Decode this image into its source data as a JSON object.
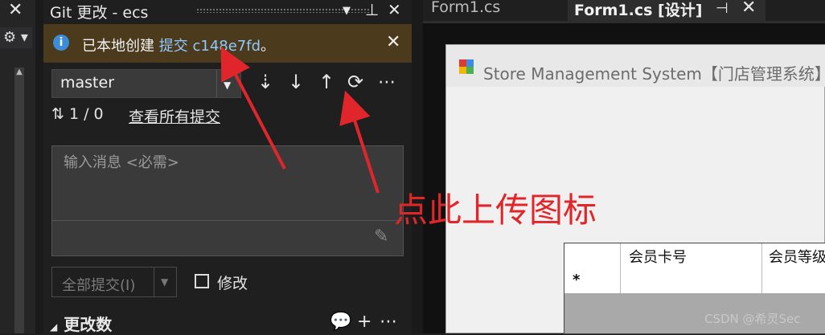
{
  "left_strip": {
    "close": "✕",
    "gear": "⚙"
  },
  "git_panel": {
    "title": "Git 更改 - ecs",
    "info": {
      "prefix": "已本地创建 ",
      "link_label": "提交",
      "commit_hash": "c148e7fd",
      "suffix": "。"
    },
    "branch": "master",
    "sync_status": "1 / 0",
    "view_all_commits": "查看所有提交",
    "message_placeholder": "输入消息 <必需>",
    "commit_all": "全部提交(I)",
    "amend": "修改",
    "changes_header": "更改数"
  },
  "editor": {
    "tabs": [
      {
        "label": "Form1.cs"
      },
      {
        "label": "Form1.cs [设计]"
      }
    ],
    "form_title": "Store Management System【门店管理系统】",
    "grid": {
      "columns": [
        "会员卡号",
        "会员等级"
      ],
      "new_row_marker": "*"
    }
  },
  "annotation": "点此上传图标",
  "watermark": "CSDN @希灵Sec",
  "colors": {
    "annotation": "#e0262a",
    "info_bar": "#4b3a1c",
    "link": "#8ec9ff"
  }
}
